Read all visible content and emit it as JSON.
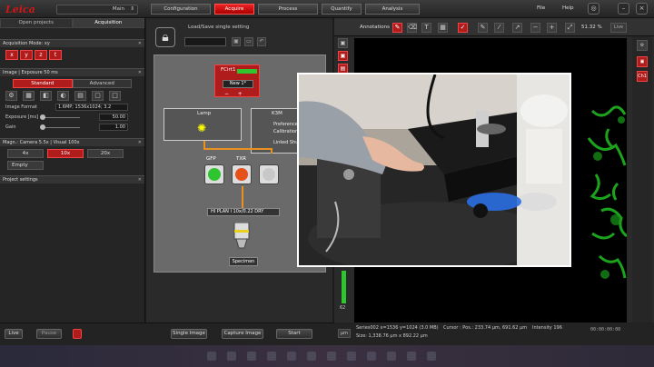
{
  "topbar": {
    "main_select": "Main",
    "tabs": [
      "Configuration",
      "Acquire",
      "Process",
      "Quantify",
      "Analysis"
    ],
    "menu": [
      "File",
      "Help"
    ]
  },
  "left": {
    "tabs": [
      "Open projects",
      "Acquisition"
    ],
    "acq_mode": "Acquisition Mode: xy",
    "xyzt": [
      "x",
      "y",
      "z",
      "t"
    ],
    "image_header": "Image | Exposure 50 ms",
    "modes": [
      "Standard",
      "Advanced"
    ],
    "image_format_label": "Image Format",
    "image_format_value": "1.6MP; 1536x1024; 3.2",
    "exposure_label": "Exposure [ms]",
    "exposure_value": "50.00",
    "gain_label": "Gain",
    "gain_value": "1.00",
    "magn_header": "Magn.: Camera 5.5x | Visual 100x",
    "objectives": [
      "4x",
      "10x",
      "20x"
    ],
    "empty_label": "Empty",
    "project_settings": "Project settings"
  },
  "center": {
    "load_save": "Load/Save single setting",
    "fc_label": "FCirt1",
    "fc_select": "New 1*",
    "lamp_label": "Lamp",
    "k3m_label": "K3M",
    "k3m_lines": [
      "Preferences",
      "Calibration",
      "Linked Shutter"
    ],
    "filters": [
      "GFP",
      "TXR"
    ],
    "objective_select": "HI PLAN I  10x/0.22 DRY",
    "specimen": "Specimen"
  },
  "viewer": {
    "annotations": "Annotations",
    "zoom": "51.32 %",
    "live": "Live",
    "ch1": "Ch1",
    "scale_value": "62"
  },
  "bottom": {
    "live": "Live",
    "pause": "Pause",
    "single_image": "Single Image",
    "capture_image": "Capture Image",
    "start": "Start"
  },
  "status": {
    "unit": "µm",
    "line1": "Series002 x=1536 y=1024 (3.0 MB)",
    "line2": "Size: 1,338.76 µm x 892.22 µm",
    "cursor": "Cursor :  Pos.: 233.74 µm, 691.62 µm",
    "intensity": "Intensity 196",
    "time": "00:00:00:00"
  },
  "colors": {
    "accent_red": "#b01c1c",
    "gfp_green": "#2ec52e",
    "txr_orange": "#e8501a"
  }
}
